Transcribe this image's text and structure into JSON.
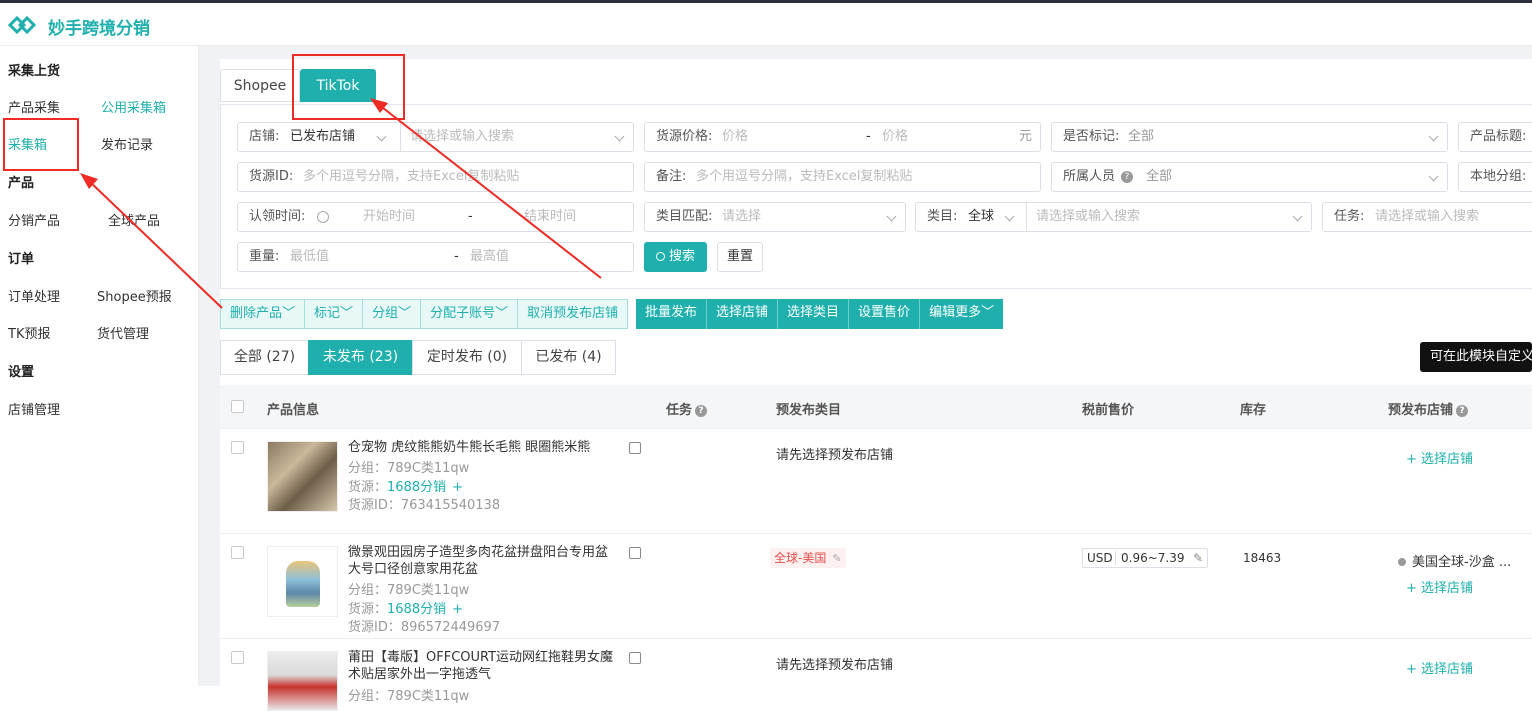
{
  "app": {
    "brand": "妙手跨境分销"
  },
  "sidebar": {
    "sections": [
      {
        "title": "采集上货",
        "items": [
          "产品采集",
          "公用采集箱",
          "采集箱",
          "发布记录"
        ]
      },
      {
        "title": "产品",
        "items": [
          "分销产品",
          "全球产品"
        ]
      },
      {
        "title": "订单",
        "items": [
          "订单处理",
          "Shopee预报",
          "TK预报",
          "货代管理"
        ]
      },
      {
        "title": "设置",
        "items": [
          "店铺管理"
        ]
      }
    ]
  },
  "platform_tabs": [
    "Shopee",
    "TikTok"
  ],
  "filters": {
    "store_label": "店铺:",
    "store_value": "已发布店铺",
    "store_search_ph": "请选择或输入搜索",
    "price_label": "货源价格:",
    "price_min_ph": "价格",
    "price_dash": "-",
    "price_max_ph": "价格",
    "price_unit": "元",
    "marked_label": "是否标记:",
    "marked_value": "全部",
    "title_label": "产品标题:",
    "source_id_label": "货源ID:",
    "source_id_ph": "多个用逗号分隔，支持Excel复制粘贴",
    "note_label": "备注:",
    "note_ph": "多个用逗号分隔，支持Excel复制粘贴",
    "owner_label": "所属人员",
    "owner_value": "全部",
    "local_group_label": "本地分组:",
    "claim_label": "认领时间:",
    "claim_start_ph": "开始时间",
    "claim_dash": "-",
    "claim_end_ph": "结束时间",
    "cat_match_label": "类目匹配:",
    "cat_match_ph": "请选择",
    "cat_label": "类目:",
    "cat_value": "全球",
    "cat_search_ph": "请选择或输入搜索",
    "task_label": "任务:",
    "task_ph": "请选择或输入搜索",
    "weight_label": "重量:",
    "weight_min_ph": "最低值",
    "weight_dash": "-",
    "weight_max_ph": "最高值",
    "search_btn": "搜索",
    "reset_btn": "重置"
  },
  "actions_light": [
    "删除产品",
    "标记",
    "分组",
    "分配子账号",
    "取消预发布店铺"
  ],
  "actions_dark": [
    "批量发布",
    "选择店铺",
    "选择类目",
    "设置售价",
    "编辑更多"
  ],
  "status_tabs": [
    "全部 (27)",
    "未发布 (23)",
    "定时发布 (0)",
    "已发布 (4)"
  ],
  "tip": "可在此模块自定义",
  "table": {
    "headers": [
      "产品信息",
      "任务",
      "预发布类目",
      "税前售价",
      "库存",
      "预发布店铺"
    ],
    "rows": [
      {
        "title": "仓宠物 虎纹熊熊奶牛熊长毛熊 眼圈熊米熊",
        "group": "分组：789C类11qw",
        "source_prefix": "货源：",
        "source": "1688分销",
        "source_id": "货源ID：763415540138",
        "category": "请先选择预发布店铺",
        "store_link": "+ 选择店铺"
      },
      {
        "title": "微景观田园房子造型多肉花盆拼盘阳台专用盆大号口径创意家用花盆",
        "group": "分组：789C类11qw",
        "source_prefix": "货源：",
        "source": "1688分销",
        "source_id": "货源ID：896572449697",
        "category_tag": "全球-美国",
        "currency": "USD",
        "price": "0.96~7.39",
        "stock": "18463",
        "store": "美国全球-沙盒 ...",
        "store_link": "+ 选择店铺"
      },
      {
        "title": "莆田【毒版】OFFCOURT运动网红拖鞋男女魔术贴居家外出一字拖透气",
        "group": "分组：789C类11qw",
        "category": "请先选择预发布店铺",
        "store_link": "+ 选择店铺"
      }
    ]
  },
  "colors": {
    "accent": "#1fb0ad",
    "annotation": "#ee2b24"
  }
}
